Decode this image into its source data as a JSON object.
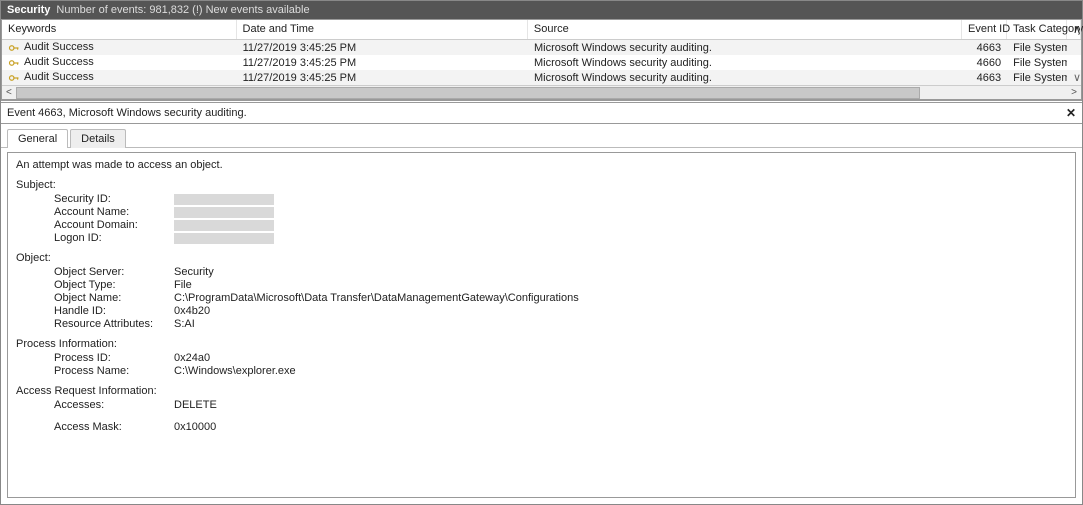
{
  "titlebar": {
    "title": "Security",
    "tail": "Number of events: 981,832 (!) New events available"
  },
  "columns": {
    "keywords": "Keywords",
    "datetime": "Date and Time",
    "source": "Source",
    "eventid": "Event ID",
    "taskcat": "Task Category"
  },
  "events": [
    {
      "keywords": "Audit Success",
      "datetime": "11/27/2019 3:45:25 PM",
      "source": "Microsoft Windows security auditing.",
      "eventid": "4663",
      "taskcat": "File System"
    },
    {
      "keywords": "Audit Success",
      "datetime": "11/27/2019 3:45:25 PM",
      "source": "Microsoft Windows security auditing.",
      "eventid": "4660",
      "taskcat": "File System"
    },
    {
      "keywords": "Audit Success",
      "datetime": "11/27/2019 3:45:25 PM",
      "source": "Microsoft Windows security auditing.",
      "eventid": "4663",
      "taskcat": "File System"
    }
  ],
  "detail": {
    "header": "Event 4663, Microsoft Windows security auditing.",
    "tabs": {
      "general": "General",
      "details": "Details"
    },
    "message": "An attempt was made to access an object.",
    "subject_label": "Subject:",
    "subject": {
      "security_id_k": "Security ID:",
      "account_name_k": "Account Name:",
      "account_domain_k": "Account Domain:",
      "logon_id_k": "Logon ID:"
    },
    "object_label": "Object:",
    "object": {
      "server_k": "Object Server:",
      "server_v": "Security",
      "type_k": "Object Type:",
      "type_v": "File",
      "name_k": "Object Name:",
      "name_v": "C:\\ProgramData\\Microsoft\\Data Transfer\\DataManagementGateway\\Configurations",
      "handle_k": "Handle ID:",
      "handle_v": "0x4b20",
      "resattr_k": "Resource Attributes:",
      "resattr_v": "S:AI"
    },
    "process_label": "Process Information:",
    "process": {
      "pid_k": "Process ID:",
      "pid_v": "0x24a0",
      "name_k": "Process Name:",
      "name_v": "C:\\Windows\\explorer.exe"
    },
    "access_label": "Access Request Information:",
    "access": {
      "accesses_k": "Accesses:",
      "accesses_v": "DELETE",
      "mask_k": "Access Mask:",
      "mask_v": "0x10000"
    }
  },
  "glyphs": {
    "close": "✕",
    "up": "∧",
    "down": "∨",
    "left": "<",
    "right": ">"
  }
}
